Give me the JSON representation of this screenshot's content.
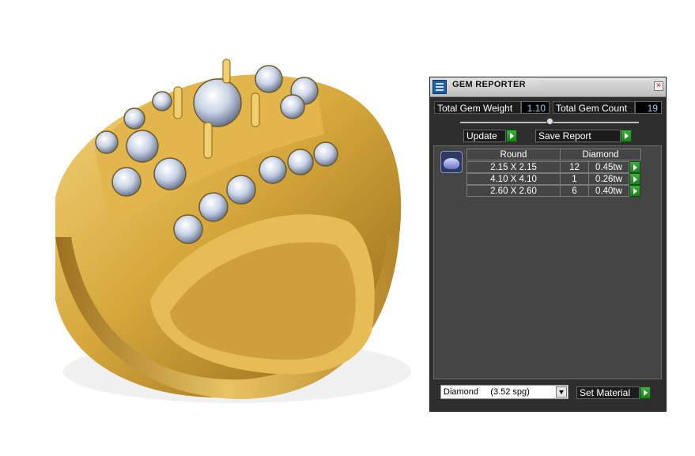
{
  "window": {
    "title": "GEM REPORTER",
    "close_glyph": "×"
  },
  "stats": {
    "weight_label": "Total Gem Weight",
    "weight_value": "1.10",
    "count_label": "Total Gem Count",
    "count_value": "19"
  },
  "slider": {
    "level": 0.5
  },
  "actions": {
    "update_label": "Update",
    "save_label": "Save Report"
  },
  "table": {
    "shape": "Round",
    "material": "Diamond",
    "rows": [
      {
        "size": "2.15 X 2.15",
        "count": "12",
        "weight": "0.45tw"
      },
      {
        "size": "4.10 X 4.10",
        "count": "1",
        "weight": "0.26tw"
      },
      {
        "size": "2.60 X 2.60",
        "count": "6",
        "weight": "0.40tw"
      }
    ]
  },
  "material_select": {
    "value": "Diamond     (3.52 spg)",
    "set_label": "Set Material"
  },
  "icons": {
    "app": "gem-reporter-icon",
    "gem": "round-diamond-icon",
    "go": "green-arrow-icon"
  },
  "colors": {
    "panel": "#2e2e2e",
    "accent_go": "#2e9a2e",
    "gold": "#c99b2a"
  }
}
